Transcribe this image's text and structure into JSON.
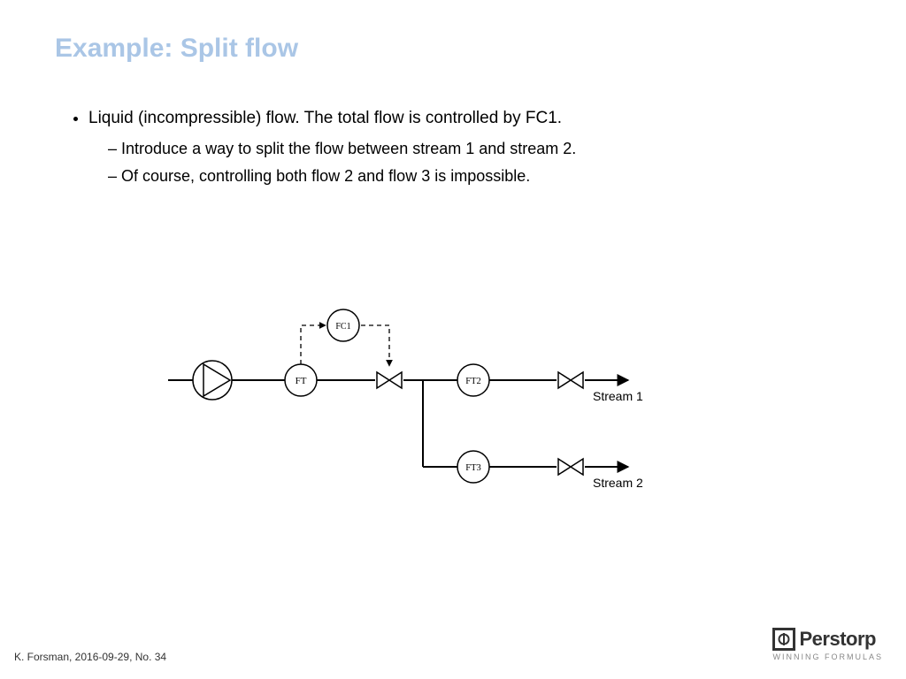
{
  "title": "Example: Split flow",
  "bullets": {
    "main": "Liquid (incompressible) flow. The total flow is controlled by FC1.",
    "sub1": "Introduce a way to split the flow between stream 1 and stream 2.",
    "sub2": "Of course, controlling both flow 2 and flow 3 is impossible."
  },
  "diagram": {
    "fc1": "FC1",
    "ft": "FT",
    "ft2": "FT2",
    "ft3": "FT3",
    "stream1": "Stream 1",
    "stream2": "Stream 2"
  },
  "footer": "K. Forsman, 2016-09-29, No. 34",
  "logo": {
    "name": "Perstorp",
    "tag": "WINNING FORMULAS"
  }
}
